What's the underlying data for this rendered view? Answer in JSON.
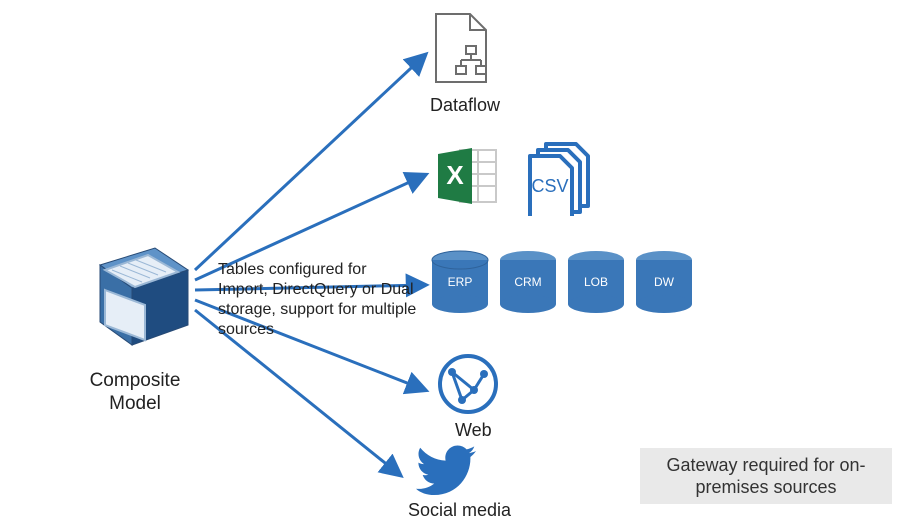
{
  "model": {
    "label": "Composite Model"
  },
  "midText": "Tables configured for Import, DirectQuery or Dual storage, support for multiple sources",
  "targets": {
    "dataflow": {
      "label": "Dataflow"
    },
    "excel": {
      "label": "Excel"
    },
    "csv": {
      "short": "CSV"
    },
    "web": {
      "label": "Web"
    },
    "social": {
      "label": "Social media"
    }
  },
  "databases": [
    {
      "label": "ERP"
    },
    {
      "label": "CRM"
    },
    {
      "label": "LOB"
    },
    {
      "label": "DW"
    }
  ],
  "note": "Gateway required for on-premises sources",
  "colors": {
    "arrowBlue": "#2a6fbc",
    "excelGreen": "#1f7b44",
    "dbBlue": "#3a77b8",
    "grey": "#6d6d6d"
  }
}
